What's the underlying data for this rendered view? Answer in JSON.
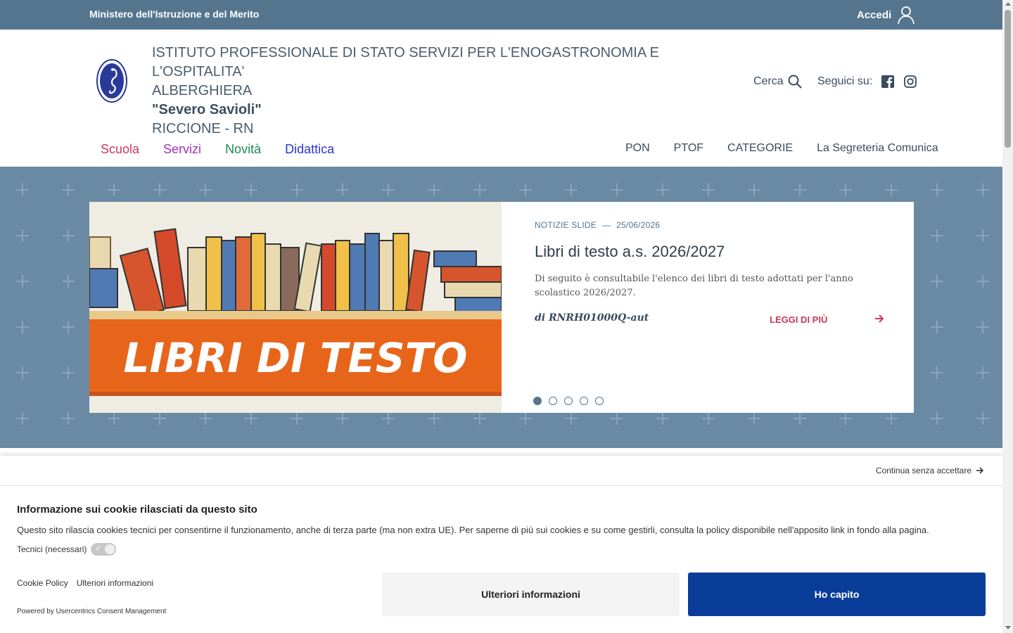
{
  "topbar": {
    "ministry": "Ministero dell'Istruzione e del Merito",
    "login_label": "Accedi"
  },
  "header": {
    "name_line1": "ISTITUTO PROFESSIONALE DI STATO SERVIZI PER L'ENOGASTRONOMIA E L'OSPITALITA'",
    "name_line2": "ALBERGHIERA",
    "name_line3": "\"Severo Savioli\"",
    "name_line4": "RICCIONE - RN",
    "search_label": "Cerca",
    "follow_label": "Seguici su:"
  },
  "mainnav": [
    "Scuola",
    "Servizi",
    "Novità",
    "Didattica"
  ],
  "secnav": [
    "PON",
    "PTOF",
    "CATEGORIE",
    "La Segreteria Comunica"
  ],
  "slide": {
    "image_text": "LIBRI DI TESTO",
    "category": "NOTIZIE SLIDE",
    "dash": "—",
    "date": "25/06/2026",
    "title": "Libri di testo a.s. 2026/2027",
    "text": "Di seguito è consultabile l'elenco dei libri di testo adottati per l'anno scolastico 2026/2027.",
    "author": "di RNRH01000Q-aut",
    "more": "LEGGI DI PIÙ",
    "dots": 5,
    "active_dot": 1
  },
  "cookie": {
    "continue": "Continua senza accettare",
    "title": "Informazione sui cookie rilasciati da questo sito",
    "description": "Questo sito rilascia cookies tecnici per consentirne il funzionamento, anche di terza parte (ma non extra UE). Per saperne di più sui cookies e su come gestirli, consulta la policy disponibile nell'apposito link in fondo alla pagina.",
    "technical": "Tecnici (necessari)",
    "link_policy": "Cookie Policy",
    "link_more": "Ulteriori informazioni",
    "powered": "Powered by Usercentrics Consent Management",
    "btn_more": "Ulteriori informazioni",
    "btn_ok": "Ho capito"
  },
  "colors": {
    "topbar": "#55758f",
    "hero": "#6a8aa4",
    "accent_red": "#c9395a",
    "primary_button": "#0a3d9a"
  }
}
